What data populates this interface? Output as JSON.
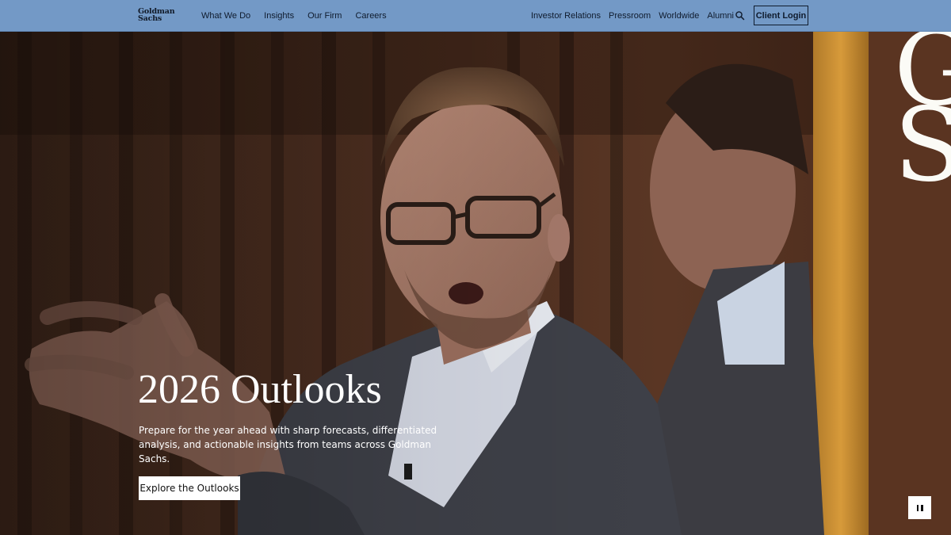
{
  "brand": {
    "logo_line1": "Goldman",
    "logo_line2": "Sachs",
    "monogram_g": "G",
    "monogram_s": "S"
  },
  "nav": {
    "primary": [
      "What We Do",
      "Insights",
      "Our Firm",
      "Careers"
    ],
    "secondary": [
      "Investor Relations",
      "Pressroom",
      "Worldwide",
      "Alumni"
    ],
    "search_icon": "search-icon",
    "client_login": "Client Login",
    "bar_color": "#7399c6"
  },
  "hero": {
    "title": "2026 Outlooks",
    "description": "Prepare for the year ahead with sharp forecasts, differentiated analysis, and actionable insights from teams across Goldman Sachs.",
    "cta": "Explore the Outlooks",
    "pause_icon": "pause-icon"
  }
}
